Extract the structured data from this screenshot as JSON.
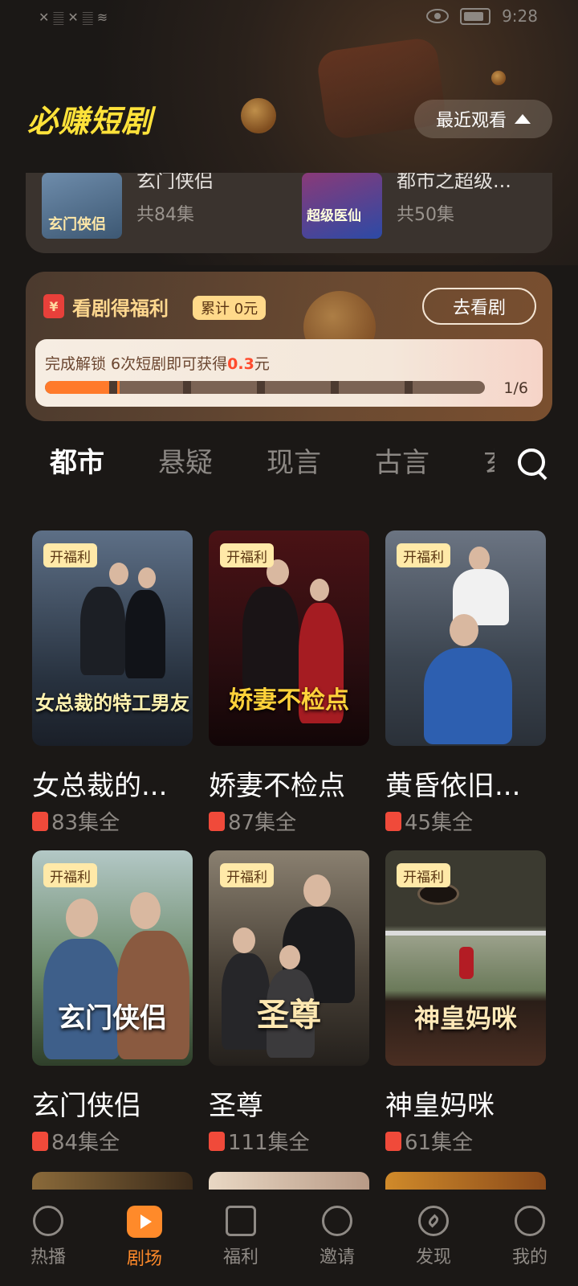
{
  "status_bar": {
    "left_icons": "✕ 𝄛 ✕ 𝄛 ≋",
    "time": "9:28"
  },
  "header": {
    "title": "必赚短剧",
    "recent_label": "最近观看"
  },
  "recent": [
    {
      "name": "玄门侠侣",
      "count": "共84集",
      "thumb_label": "玄门侠侣"
    },
    {
      "name": "都市之超级...",
      "count": "共50集",
      "thumb_label": "超级医仙"
    }
  ],
  "welfare": {
    "icon": "¥",
    "title": "看剧得福利",
    "badge": "累计 0元",
    "button": "去看剧",
    "progress_text_prefix": "完成解锁 6次短剧即可获得",
    "progress_reward": "0.3",
    "progress_text_suffix": "元",
    "progress_label": "1/6",
    "progress_value": 0.17
  },
  "tabs": [
    "都市",
    "悬疑",
    "现言",
    "古言",
    "玄"
  ],
  "tag_label": "开福利",
  "dramas": [
    {
      "title": "女总裁的...",
      "poster_text": "女总裁的特工男友",
      "eps": "83集全",
      "tone": "#3a4a60"
    },
    {
      "title": "娇妻不检点",
      "poster_text": "娇妻不检点",
      "eps": "87集全",
      "tone": "#5a1a1e"
    },
    {
      "title": "黄昏依旧...",
      "poster_text": "",
      "eps": "45集全",
      "tone": "#4d5866"
    },
    {
      "title": "玄门侠侣",
      "poster_text": "玄门侠侣",
      "eps": "84集全",
      "tone": "#4e6a3e"
    },
    {
      "title": "圣尊",
      "poster_text": "圣尊",
      "eps": "111集全",
      "tone": "#3e3a36"
    },
    {
      "title": "神皇妈咪",
      "poster_text": "神皇妈咪",
      "eps": "61集全",
      "tone": "#3b4a2c"
    }
  ],
  "nav": [
    {
      "label": "热播",
      "icon": "flame-play-icon"
    },
    {
      "label": "剧场",
      "icon": "tv-play-icon"
    },
    {
      "label": "福利",
      "icon": "gift-icon"
    },
    {
      "label": "邀请",
      "icon": "users-icon"
    },
    {
      "label": "发现",
      "icon": "compass-icon"
    },
    {
      "label": "我的",
      "icon": "profile-icon"
    }
  ],
  "colors": {
    "accent": "#ff8a2a",
    "title_yellow": "#ffe23a",
    "background": "#1b1816"
  }
}
